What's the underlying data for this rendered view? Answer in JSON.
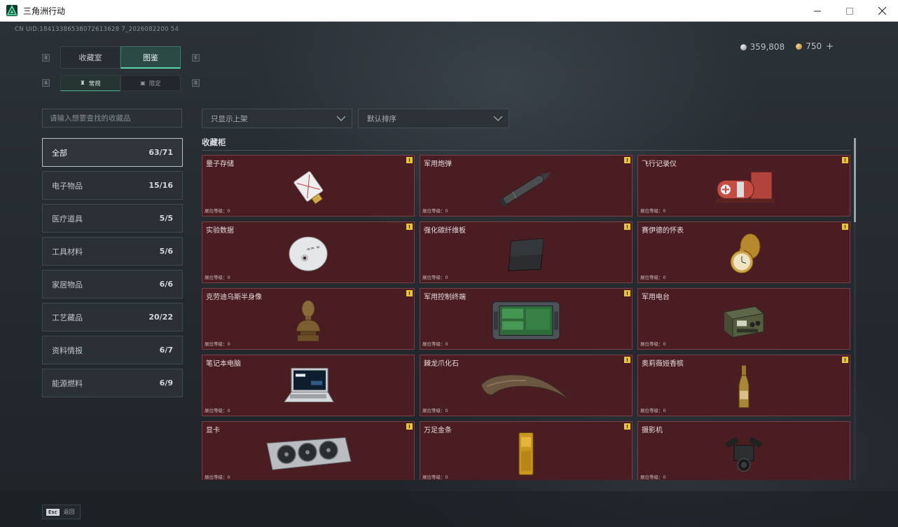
{
  "window": {
    "title": "三角洲行动",
    "controls": {
      "minimize": "—",
      "maximize": "☐",
      "close": "✕"
    }
  },
  "uid": "CN UID:18413386538072613628 7_2026082200 54",
  "currency": {
    "silver": "359,808",
    "gold": "750",
    "plus": "+"
  },
  "keys": {
    "q": "Q",
    "e": "E",
    "a": "A",
    "d": "D",
    "esc": "Esc"
  },
  "tabs": {
    "main": [
      "收藏室",
      "图鉴"
    ],
    "main_active": 1,
    "sub": [
      "常规",
      "限定"
    ],
    "sub_active": 0
  },
  "search": {
    "placeholder": "请输入想要查找的收藏品"
  },
  "categories": [
    {
      "label": "全部",
      "count": "63/71",
      "active": true
    },
    {
      "label": "电子物品",
      "count": "15/16"
    },
    {
      "label": "医疗道具",
      "count": "5/5"
    },
    {
      "label": "工具材料",
      "count": "5/6"
    },
    {
      "label": "家居物品",
      "count": "6/6"
    },
    {
      "label": "工艺藏品",
      "count": "20/22"
    },
    {
      "label": "资料情报",
      "count": "6/7"
    },
    {
      "label": "能源燃料",
      "count": "6/9"
    }
  ],
  "filters": {
    "shelf": "只显示上架",
    "sort": "默认排序"
  },
  "section": {
    "title": "收藏柜"
  },
  "items": [
    {
      "name": "量子存储",
      "level": "展位等级：0",
      "warn": true,
      "icon": "usb-drive-icon"
    },
    {
      "name": "军用炮弹",
      "level": "展位等级：0",
      "warn": true,
      "icon": "artillery-shell-icon"
    },
    {
      "name": "飞行记录仪",
      "level": "展位等级：0",
      "warn": true,
      "icon": "flight-recorder-icon"
    },
    {
      "name": "实验数据",
      "level": "展位等级：0",
      "warn": true,
      "icon": "disc-icon"
    },
    {
      "name": "强化碳纤维板",
      "level": "展位等级：0",
      "warn": true,
      "icon": "carbon-plate-icon"
    },
    {
      "name": "赛伊德的怀表",
      "level": "展位等级：0",
      "warn": true,
      "icon": "pocket-watch-icon"
    },
    {
      "name": "克劳迪乌斯半身像",
      "level": "展位等级：0",
      "warn": true,
      "icon": "bust-icon"
    },
    {
      "name": "军用控制终端",
      "level": "展位等级：0",
      "warn": true,
      "icon": "tablet-terminal-icon"
    },
    {
      "name": "军用电台",
      "level": "展位等级：0",
      "warn": false,
      "icon": "radio-icon"
    },
    {
      "name": "笔记本电脑",
      "level": "展位等级：0",
      "warn": false,
      "icon": "laptop-icon"
    },
    {
      "name": "棘龙爪化石",
      "level": "展位等级：0",
      "warn": true,
      "icon": "claw-fossil-icon"
    },
    {
      "name": "奥莉薇娅香槟",
      "level": "展位等级：0",
      "warn": true,
      "icon": "champagne-icon"
    },
    {
      "name": "显卡",
      "level": "展位等级：0",
      "warn": true,
      "icon": "graphics-card-icon"
    },
    {
      "name": "万足金条",
      "level": "展位等级：0",
      "warn": true,
      "icon": "gold-bar-icon"
    },
    {
      "name": "摄影机",
      "level": "展位等级：0",
      "warn": false,
      "icon": "camera-icon"
    }
  ],
  "footer": {
    "back_label": "返回"
  },
  "colors": {
    "accent": "#58d6a6",
    "card_bg": "#4a1d23",
    "warn": "#e7c43a"
  }
}
